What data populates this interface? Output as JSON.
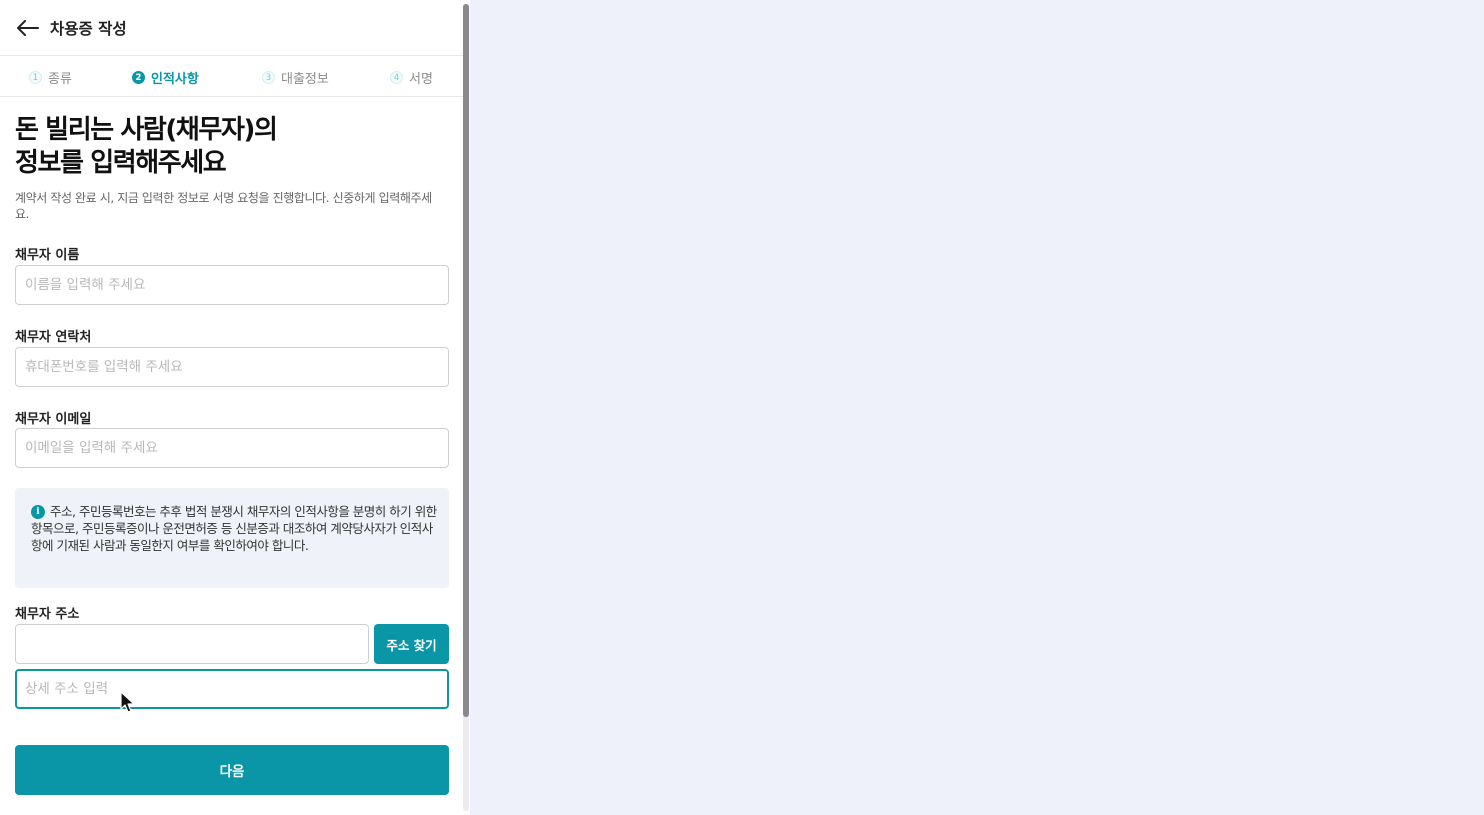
{
  "header": {
    "title": "차용증 작성",
    "back_icon": "arrow-left-icon"
  },
  "steps": [
    {
      "num": "1",
      "label": "종류",
      "state": "done"
    },
    {
      "num": "2",
      "label": "인적사항",
      "state": "active"
    },
    {
      "num": "3",
      "label": "대출정보",
      "state": "upcoming"
    },
    {
      "num": "4",
      "label": "서명",
      "state": "upcoming"
    }
  ],
  "main": {
    "headline_line1": "돈 빌리는 사람(채무자)의",
    "headline_line2": "정보를 입력해주세요",
    "description": "계약서 작성 완료 시, 지금 입력한 정보로 서명 요청을 진행합니다. 신중하게 입력해주세요."
  },
  "form": {
    "name": {
      "label": "채무자 이름",
      "placeholder": "이름을 입력해 주세요",
      "value": ""
    },
    "phone": {
      "label": "채무자 연락처",
      "placeholder": "휴대폰번호를 입력해 주세요",
      "value": ""
    },
    "email": {
      "label": "채무자 이메일",
      "placeholder": "이메일을 입력해 주세요",
      "value": ""
    },
    "address": {
      "label": "채무자 주소",
      "value": "",
      "search_button": "주소 찾기",
      "detail_placeholder": "상세 주소 입력"
    }
  },
  "notice": {
    "icon": "info-icon",
    "text": "주소, 주민등록번호는 추후 법적 분쟁시 채무자의 인적사항을 분명히 하기 위한 항목으로, 주민등록증이나 운전면허증 등 신분증과 대조하여 계약당사자가 인적사항에 기재된 사람과 동일한지 여부를 확인하여야 합니다."
  },
  "footer": {
    "next_button": "다음"
  },
  "colors": {
    "accent": "#0a96a6",
    "background": "#eef1f9",
    "notice_bg": "#eff2f8"
  }
}
